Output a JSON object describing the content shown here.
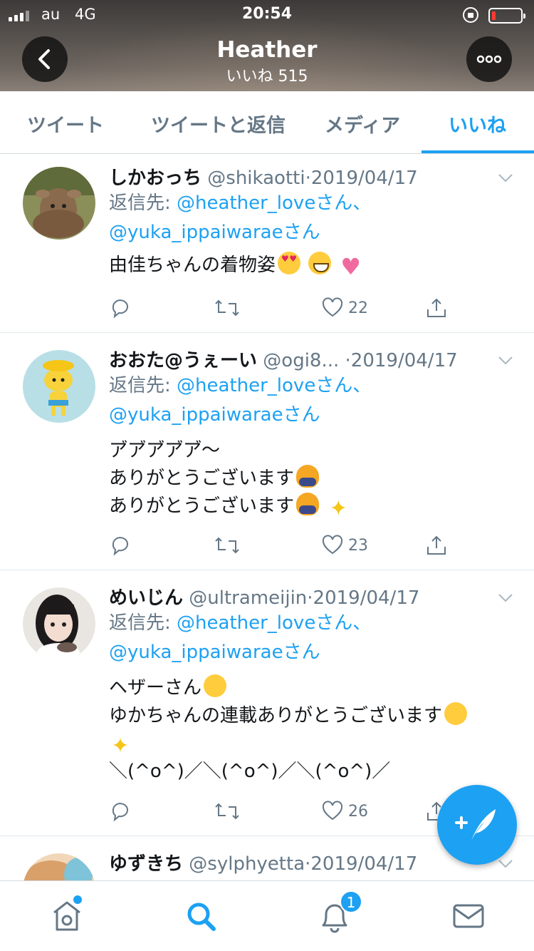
{
  "status_bar": {
    "carrier": "au",
    "network": "4G",
    "time": "20:54"
  },
  "header": {
    "title": "Heather",
    "subtitle": "いいね 515"
  },
  "tabs": [
    {
      "label": "ツイート",
      "active": false
    },
    {
      "label": "ツイートと返信",
      "active": false
    },
    {
      "label": "メディア",
      "active": false
    },
    {
      "label": "いいね",
      "active": true
    }
  ],
  "tweets": [
    {
      "name": "しかおっち",
      "handle": "@shikaotti",
      "dot": "·",
      "date": "2019/04/17",
      "reply_label": "返信先: ",
      "reply_to_1": "@heather_loveさん、",
      "reply_to_2": "@yuka_ippaiwaraeさん",
      "text": "由佳ちゃんの着物姿",
      "likes": "22"
    },
    {
      "name": "おおた@うぇーい",
      "handle": "@ogi8...",
      "dot": "·",
      "date": "2019/04/17",
      "reply_label": "返信先: ",
      "reply_to_1": "@heather_loveさん、",
      "reply_to_2": "@yuka_ippaiwaraeさん",
      "text_line1": "ア゙ア゙ア゙ア゙ア゙〜",
      "text_line2": "ありがとうございます",
      "text_line3": "ありがとうございます",
      "likes": "23"
    },
    {
      "name": "めいじん",
      "handle": "@ultrameijin",
      "dot": "·",
      "date": "2019/04/17",
      "reply_label": "返信先: ",
      "reply_to_1": "@heather_loveさん、",
      "reply_to_2": "@yuka_ippaiwaraeさん",
      "text_line1": "ヘザーさん",
      "text_line2": "ゆかちゃんの連載ありがとうございます",
      "text_line4": "＼(^o^)／＼(^o^)／＼(^o^)／",
      "likes": "26"
    },
    {
      "name": "ゆずきち",
      "handle": "@sylphyetta",
      "dot": "·",
      "date": "2019/04/17"
    }
  ],
  "bottom_nav": {
    "notifications_badge": "1"
  },
  "colors": {
    "accent": "#1da1f2",
    "text": "#14171a",
    "secondary": "#657786"
  }
}
